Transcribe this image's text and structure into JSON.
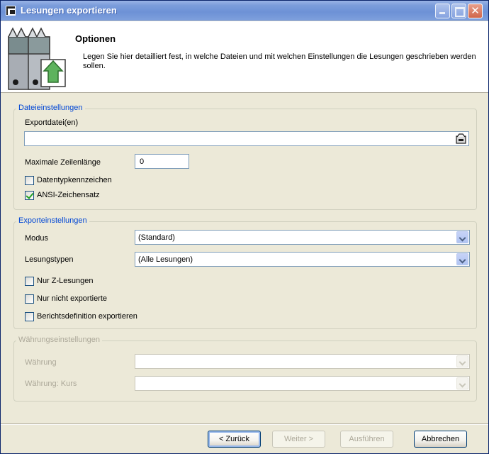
{
  "window": {
    "title": "Lesungen exportieren"
  },
  "header": {
    "title": "Optionen",
    "description": "Legen Sie hier detailliert fest, in welche Dateien und mit welchen Einstellungen die Lesungen geschrieben werden sollen."
  },
  "file_settings": {
    "group_label": "Dateieinstellungen",
    "export_files_label": "Exportdatei(en)",
    "export_files_value": "",
    "max_line_length_label": "Maximale Zeilenlänge",
    "max_line_length_value": "0",
    "datatype_marker_label": "Datentypkennzeichen",
    "datatype_marker_checked": false,
    "ansi_charset_label": "ANSI-Zeichensatz",
    "ansi_charset_checked": true
  },
  "export_settings": {
    "group_label": "Exporteinstellungen",
    "mode_label": "Modus",
    "mode_value": "(Standard)",
    "reading_types_label": "Lesungstypen",
    "reading_types_value": "(Alle Lesungen)",
    "only_z_readings_label": "Nur Z-Lesungen",
    "only_not_exported_label": "Nur nicht exportierte",
    "export_report_definition_label": "Berichtsdefinition exportieren"
  },
  "currency_settings": {
    "group_label": "Währungseinstellungen",
    "currency_label": "Währung",
    "currency_value": "",
    "currency_rate_label": "Währung: Kurs",
    "currency_rate_value": ""
  },
  "buttons": {
    "back": "< Zurück",
    "next": "Weiter >",
    "execute": "Ausführen",
    "cancel": "Abbrechen"
  },
  "colors": {
    "title_bar": "#7b9ddb",
    "group_label": "#0046d5",
    "dialog_bg": "#ece9d8"
  }
}
